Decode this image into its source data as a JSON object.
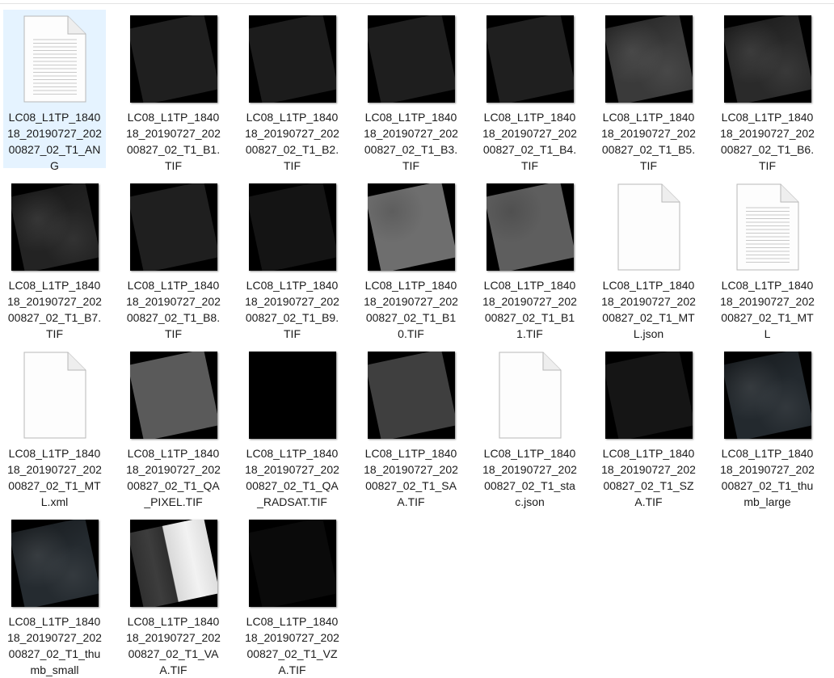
{
  "files": [
    {
      "name": "LC08_L1TP_184018_20190727_20200827_02_T1_ANG",
      "type": "text-doc",
      "selected": true
    },
    {
      "name": "LC08_L1TP_184018_20190727_20200827_02_T1_B1.TIF",
      "type": "image",
      "scene_color": "#1f1f1f",
      "tone": "dark"
    },
    {
      "name": "LC08_L1TP_184018_20190727_20200827_02_T1_B2.TIF",
      "type": "image",
      "scene_color": "#1c1c1c",
      "tone": "dark"
    },
    {
      "name": "LC08_L1TP_184018_20190727_20200827_02_T1_B3.TIF",
      "type": "image",
      "scene_color": "#1e1e1e",
      "tone": "dark"
    },
    {
      "name": "LC08_L1TP_184018_20190727_20200827_02_T1_B4.TIF",
      "type": "image",
      "scene_color": "#1f1f1f",
      "tone": "dark"
    },
    {
      "name": "LC08_L1TP_184018_20190727_20200827_02_T1_B5.TIF",
      "type": "image",
      "scene_color": "#3a3a3a",
      "tone": "textured"
    },
    {
      "name": "LC08_L1TP_184018_20190727_20200827_02_T1_B6.TIF",
      "type": "image",
      "scene_color": "#2a2a2a",
      "tone": "textured"
    },
    {
      "name": "LC08_L1TP_184018_20190727_20200827_02_T1_B7.TIF",
      "type": "image",
      "scene_color": "#232323",
      "tone": "textured"
    },
    {
      "name": "LC08_L1TP_184018_20190727_20200827_02_T1_B8.TIF",
      "type": "image",
      "scene_color": "#1f1f1f",
      "tone": "dark"
    },
    {
      "name": "LC08_L1TP_184018_20190727_20200827_02_T1_B9.TIF",
      "type": "image",
      "scene_color": "#141414",
      "tone": "dark"
    },
    {
      "name": "LC08_L1TP_184018_20190727_20200827_02_T1_B10.TIF",
      "type": "image",
      "scene_color": "#6e6e6e",
      "tone": "gray"
    },
    {
      "name": "LC08_L1TP_184018_20190727_20200827_02_T1_B11.TIF",
      "type": "image",
      "scene_color": "#5e5e5e",
      "tone": "gray"
    },
    {
      "name": "LC08_L1TP_184018_20190727_20200827_02_T1_MTL.json",
      "type": "blank-doc"
    },
    {
      "name": "LC08_L1TP_184018_20190727_20200827_02_T1_MTL",
      "type": "text-doc"
    },
    {
      "name": "LC08_L1TP_184018_20190727_20200827_02_T1_MTL.xml",
      "type": "blank-doc"
    },
    {
      "name": "LC08_L1TP_184018_20190727_20200827_02_T1_QA_PIXEL.TIF",
      "type": "image",
      "scene_color": "#5a5a5a",
      "tone": "flat"
    },
    {
      "name": "LC08_L1TP_184018_20190727_20200827_02_T1_QA_RADSAT.TIF",
      "type": "image",
      "scene_color": "#000000",
      "tone": "flat"
    },
    {
      "name": "LC08_L1TP_184018_20190727_20200827_02_T1_SAA.TIF",
      "type": "image",
      "scene_color": "#3f3f3f",
      "tone": "flat"
    },
    {
      "name": "LC08_L1TP_184018_20190727_20200827_02_T1_stac.json",
      "type": "blank-doc"
    },
    {
      "name": "LC08_L1TP_184018_20190727_20200827_02_T1_SZA.TIF",
      "type": "image",
      "scene_color": "#151515",
      "tone": "flat"
    },
    {
      "name": "LC08_L1TP_184018_20190727_20200827_02_T1_thumb_large",
      "type": "image",
      "scene_color": "#23292e",
      "tone": "textured"
    },
    {
      "name": "LC08_L1TP_184018_20190727_20200827_02_T1_thumb_small",
      "type": "image",
      "scene_color": "#252b30",
      "tone": "textured"
    },
    {
      "name": "LC08_L1TP_184018_20190727_20200827_02_T1_VAA.TIF",
      "type": "image",
      "scene_color": "#3c3c3c",
      "tone": "split"
    },
    {
      "name": "LC08_L1TP_184018_20190727_20200827_02_T1_VZA.TIF",
      "type": "image",
      "scene_color": "#0a0a0a",
      "tone": "flat"
    }
  ]
}
